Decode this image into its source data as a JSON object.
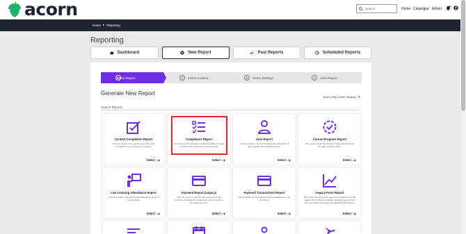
{
  "brand": {
    "name": "acorn",
    "color": "#1d2430",
    "icon": "acorn-icon"
  },
  "header": {
    "search_placeholder": "Search",
    "nav": [
      "Home",
      "Catalogue",
      "Admin"
    ],
    "icons": [
      "notification-bell-icon",
      "user-account-icon"
    ]
  },
  "breadcrumb": {
    "items": [
      "Home",
      "Reporting"
    ]
  },
  "page": {
    "title": "Reporting"
  },
  "tabs": [
    {
      "label": "Dashboard",
      "icon": "puzzle-icon",
      "active": false
    },
    {
      "label": "New Report",
      "icon": "plus-circle-icon",
      "active": true
    },
    {
      "label": "Past Reports",
      "icon": "trend-line-icon",
      "active": false
    },
    {
      "label": "Scheduled Reports",
      "icon": "clock-icon",
      "active": false
    }
  ],
  "steps": [
    {
      "number": "1",
      "label": "Select Report",
      "active": true
    },
    {
      "number": "2",
      "label": "Select Content",
      "active": false
    },
    {
      "number": "3",
      "label": "Select Settings",
      "active": false
    },
    {
      "number": "4",
      "label": "View Report",
      "active": false
    }
  ],
  "generate": {
    "title": "Generate New Report",
    "tenancy_label": "Acorn Help Centre Tenancy",
    "search_label": "Search Reports"
  },
  "accent_color": "#6f2ee6",
  "highlight_color": "#e8262a",
  "select_label": "Select",
  "cards": [
    {
      "title": "Content Completion Report",
      "icon": "checkbox-edit-icon",
      "description": "Use this report if you want to see a list of all completions for a selection of content."
    },
    {
      "title": "Compliance Report",
      "icon": "checklist-icon",
      "description": "Use this report to view the compliance status of users in a selection of Courses or its learnings.",
      "highlighted": true
    },
    {
      "title": "User Report",
      "icon": "user-icon",
      "description": "Use this report to view information about all users or any specific users training history."
    },
    {
      "title": "Course Progress Report",
      "icon": "progress-check-icon",
      "description": "This report shows the activity progress of each user through a single course."
    },
    {
      "title": "Live Learning Attendance Report",
      "icon": "presenter-icon",
      "description": "Use this report to view the list attendances for a set of live learnings."
    },
    {
      "title": "Payment Report (Legacy)",
      "icon": "credit-card-icon",
      "description": "Use this report to get the total revenue and all purchase transactions of selected content (courses, live learnings, etc)."
    },
    {
      "title": "Payment Transactions Report",
      "icon": "credit-card-icon",
      "description": "Use this report to see all payment transactions for a set of content."
    },
    {
      "title": "Legacy Form Report",
      "icon": "chart-line-icon",
      "description": "This report can be used to view form responses for the legacy forms. Please consider migrating your form to the new version and using the updated Form Report."
    },
    {
      "title": "",
      "icon": "list-icon",
      "description": ""
    },
    {
      "title": "",
      "icon": "calendar-icon",
      "description": ""
    },
    {
      "title": "",
      "icon": "user-group-icon",
      "description": ""
    },
    {
      "title": "",
      "icon": "airplane-icon",
      "description": ""
    }
  ]
}
